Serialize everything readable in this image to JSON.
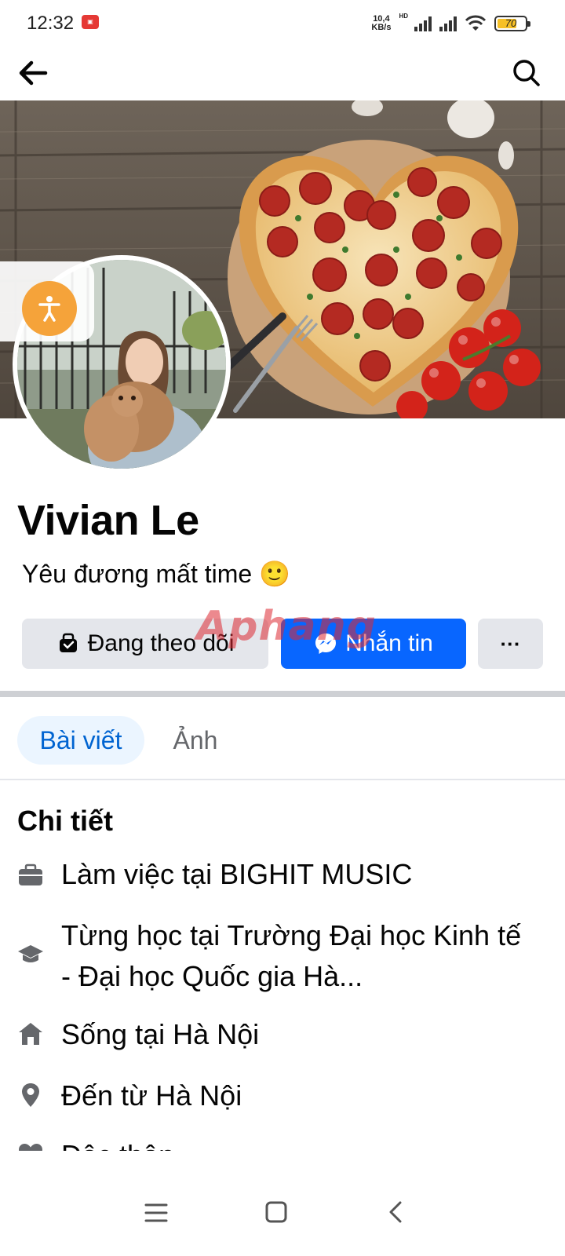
{
  "status": {
    "time": "12:32",
    "net_speed_value": "10,4",
    "net_speed_unit": "KB/s",
    "network_type": "HD",
    "battery_level": 70,
    "battery_text": "70"
  },
  "nav": {
    "back_icon": "arrow-left-icon",
    "search_icon": "search-icon"
  },
  "profile": {
    "name": "Vivian Le",
    "bio": "Yêu đương mất time 🙂"
  },
  "actions": {
    "following_label": "Đang theo dõi",
    "message_label": "Nhắn tin",
    "more_label": "···"
  },
  "watermark": "Aphang",
  "tabs": [
    {
      "label": "Bài viết",
      "active": true
    },
    {
      "label": "Ảnh",
      "active": false
    }
  ],
  "details": {
    "title": "Chi tiết",
    "items": [
      {
        "icon": "briefcase-icon",
        "text": "Làm việc tại BIGHIT MUSIC"
      },
      {
        "icon": "graduation-cap-icon",
        "text": "Từng học tại Trường Đại học Kinh tế - Đại học Quốc gia Hà..."
      },
      {
        "icon": "home-icon",
        "text": "Sống tại Hà Nội"
      },
      {
        "icon": "location-pin-icon",
        "text": "Đến từ Hà Nội"
      },
      {
        "icon": "heart-icon",
        "text": "Độc thân"
      }
    ]
  },
  "colors": {
    "primary_blue": "#0866ff",
    "tab_active_bg": "#ebf5ff",
    "tab_active_text": "#0064d1",
    "button_grey": "#e4e6eb",
    "accessibility_orange": "#f5a33a"
  }
}
